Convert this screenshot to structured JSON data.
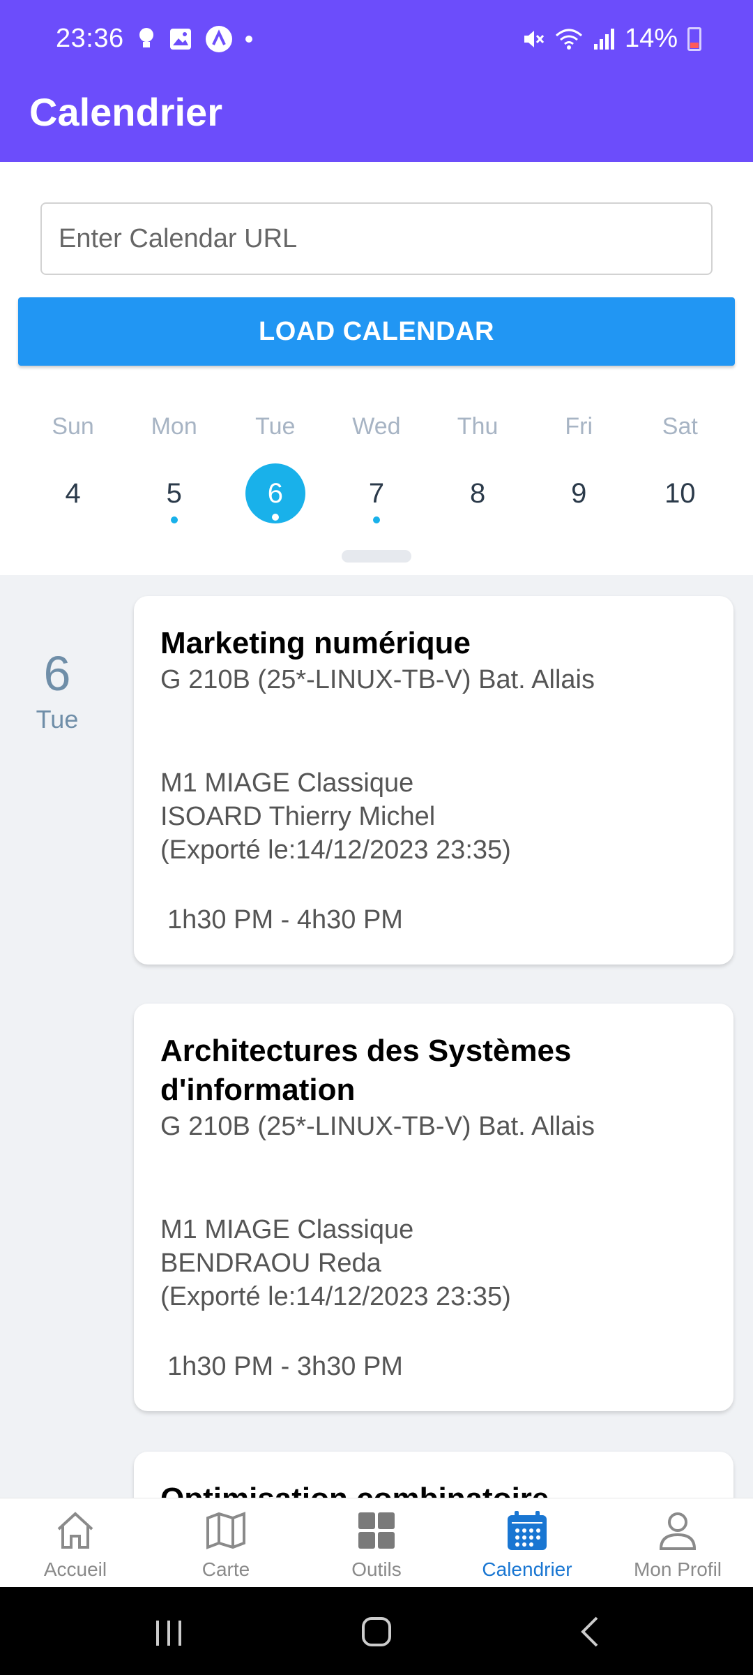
{
  "status_bar": {
    "time": "23:36",
    "battery": "14%",
    "icons": [
      "bulb-icon",
      "image-icon",
      "app-icon",
      "dot-icon",
      "mute-icon",
      "wifi-icon",
      "signal-icon",
      "battery-icon"
    ]
  },
  "app_bar": {
    "title": "Calendrier"
  },
  "url_input": {
    "placeholder": "Enter Calendar URL",
    "value": ""
  },
  "load_button": {
    "label": "LOAD CALENDAR"
  },
  "week": {
    "day_names": [
      "Sun",
      "Mon",
      "Tue",
      "Wed",
      "Thu",
      "Fri",
      "Sat"
    ],
    "dates": [
      "4",
      "5",
      "6",
      "7",
      "8",
      "9",
      "10"
    ],
    "selected_index": 2,
    "event_markers": [
      false,
      true,
      true,
      true,
      false,
      false,
      false
    ]
  },
  "agenda": {
    "day_number": "6",
    "day_name": "Tue",
    "events": [
      {
        "title": "Marketing numérique",
        "location": "G 210B (25*-LINUX-TB-V) Bat. Allais",
        "group": "M1 MIAGE Classique",
        "teacher": "ISOARD Thierry Michel",
        "exported": "(Exporté le:14/12/2023 23:35)",
        "time": "1h30 PM - 4h30 PM"
      },
      {
        "title": "Architectures des Systèmes d'information",
        "location": "G 210B (25*-LINUX-TB-V) Bat. Allais",
        "group": "M1 MIAGE Classique",
        "teacher": "BENDRAOU Reda",
        "exported": "(Exporté le:14/12/2023 23:35)",
        "time": "1h30 PM - 3h30 PM"
      },
      {
        "title": "Optimisation combinatoire"
      }
    ]
  },
  "bottom_nav": {
    "tabs": [
      {
        "label": "Accueil",
        "icon": "home-icon"
      },
      {
        "label": "Carte",
        "icon": "map-icon"
      },
      {
        "label": "Outils",
        "icon": "grid-icon"
      },
      {
        "label": "Calendrier",
        "icon": "calendar-icon"
      },
      {
        "label": "Mon Profil",
        "icon": "person-icon"
      }
    ],
    "active_index": 3,
    "active_color": "#1976d2",
    "inactive_color": "#8a8a8a"
  },
  "colors": {
    "app_bar": "#6c4dfb",
    "button": "#2196f3",
    "selected_day": "#19b1ea"
  }
}
